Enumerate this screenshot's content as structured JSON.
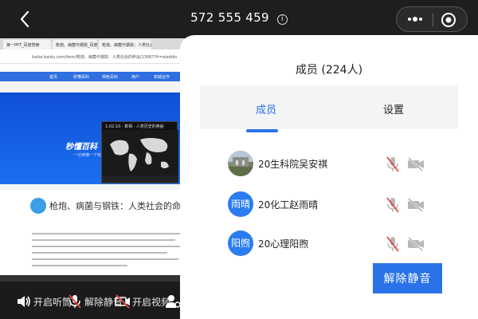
{
  "header": {
    "meeting_id": "572 555 459",
    "back_icon": "chevron-left-icon",
    "info_icon": "info-icon",
    "more_icon": "more-dots-icon",
    "close_icon": "target-circle-icon"
  },
  "shared_screen": {
    "browser_tabs": [
      "第一PPT_百度搜索",
      "枪炮、病菌与钢铁_百度搜索",
      "枪炮、病菌与钢铁：人类社会的命运..."
    ],
    "address": "baike.baidu.com/item/枪炮、病菌与钢铁：人类社会的命运/13067?fr=aladdin",
    "nav_items": [
      "首页",
      "秒懂百科",
      "特色百科",
      "用户",
      "权威合作"
    ],
    "video_caption": "1:02:10 · 真相 · 人类历史的奥秘",
    "logo_text": "秒懂百科",
    "logo_sub": "一分钟懂一个知识",
    "article_title": "枪炮、病菌与钢铁：人类社会的命运"
  },
  "toolbar": {
    "speaker_label": "开启听筒",
    "mic_label": "解除静音",
    "video_label": "开启视频"
  },
  "panel": {
    "title": "成员 (224人)",
    "tabs": [
      {
        "label": "成员",
        "active": true
      },
      {
        "label": "设置",
        "active": false
      }
    ],
    "members": [
      {
        "avatar_text": "",
        "avatar_type": "photo",
        "name": "20生科院吴安祺",
        "mic": "mic-muted-icon",
        "camera": "camera-off-icon"
      },
      {
        "avatar_text": "雨晴",
        "avatar_type": "blue",
        "name": "20化工赵雨晴",
        "mic": "mic-muted-icon",
        "camera": "camera-off-icon"
      },
      {
        "avatar_text": "阳煦",
        "avatar_type": "blue",
        "name": "20心理阳煦",
        "mic": "mic-muted-icon",
        "camera": "camera-off-icon"
      }
    ],
    "unmute_button": "解除静音"
  },
  "colors": {
    "accent": "#2a72e8",
    "muted_icon_red": "#e04444",
    "icon_gray": "#b8b8b8"
  }
}
